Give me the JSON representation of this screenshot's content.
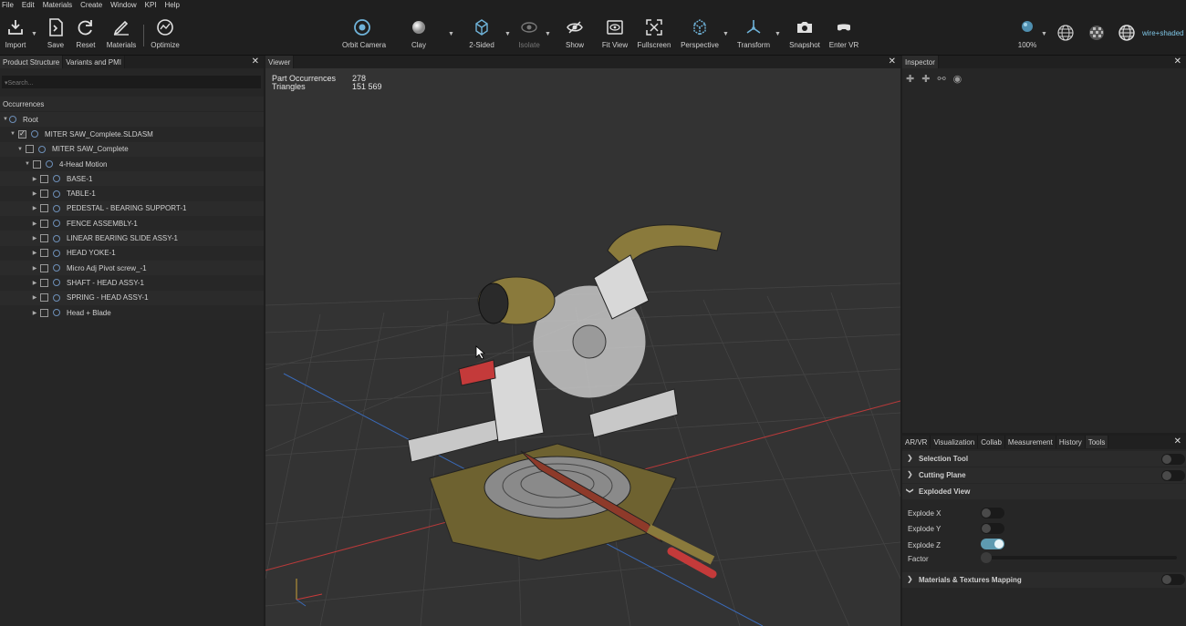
{
  "menu": [
    "File",
    "Edit",
    "Materials",
    "Create",
    "Window",
    "KPI",
    "Help"
  ],
  "toolbar": {
    "import": "Import",
    "save": "Save",
    "reset": "Reset",
    "materials": "Materials",
    "optimize": "Optimize",
    "orbit_camera": "Orbit Camera",
    "clay": "Clay",
    "two_sided": "2-Sided",
    "isolate": "Isolate",
    "show": "Show",
    "fit_view": "Fit View",
    "fullscreen": "Fullscreen",
    "perspective": "Perspective",
    "transform": "Transform",
    "snapshot": "Snapshot",
    "enter_vr": "Enter VR",
    "zoom": "100%",
    "render_mode": "wire+shaded"
  },
  "left_panel": {
    "tabs": [
      "Product Structure",
      "Variants and PMI"
    ],
    "search_placeholder": "▾Search...",
    "occurrences_label": "Occurrences",
    "tree": [
      {
        "label": "Root",
        "depth": 0
      },
      {
        "label": "MITER SAW_Complete.SLDASM",
        "depth": 1
      },
      {
        "label": "MITER SAW_Complete",
        "depth": 2
      },
      {
        "label": "4-Head Motion",
        "depth": 3
      },
      {
        "label": "BASE-1",
        "depth": 4
      },
      {
        "label": "TABLE-1",
        "depth": 4
      },
      {
        "label": "PEDESTAL - BEARING SUPPORT-1",
        "depth": 4
      },
      {
        "label": "FENCE ASSEMBLY-1",
        "depth": 4
      },
      {
        "label": "LINEAR BEARING SLIDE ASSY-1",
        "depth": 4
      },
      {
        "label": "HEAD YOKE-1",
        "depth": 4
      },
      {
        "label": "Micro Adj Pivot screw_-1",
        "depth": 4
      },
      {
        "label": "SHAFT - HEAD ASSY-1",
        "depth": 4
      },
      {
        "label": "SPRING - HEAD ASSY-1",
        "depth": 4
      },
      {
        "label": "Head + Blade",
        "depth": 4
      }
    ]
  },
  "viewer": {
    "tab": "Viewer",
    "part_occurrences_label": "Part Occurrences",
    "part_occurrences_value": "278",
    "triangles_label": "Triangles",
    "triangles_value": "151 569"
  },
  "inspector": {
    "tab": "Inspector"
  },
  "tools_panel": {
    "tabs": [
      "AR/VR",
      "Visualization",
      "Collab",
      "Measurement",
      "History",
      "Tools"
    ],
    "selection_tool": "Selection Tool",
    "cutting_plane": "Cutting Plane",
    "exploded_view": "Exploded View",
    "explode_x": "Explode X",
    "explode_y": "Explode Y",
    "explode_z": "Explode Z",
    "explode_z_on": true,
    "factor": "Factor",
    "factor_value": 0,
    "materials_mapping": "Materials & Textures Mapping"
  },
  "colors": {
    "accent": "#5e9ab0",
    "saw_body": "#8a7a3c",
    "grid": "#4a4a4a",
    "axis_x": "#b83a3a",
    "axis_z": "#3a6ab8"
  }
}
